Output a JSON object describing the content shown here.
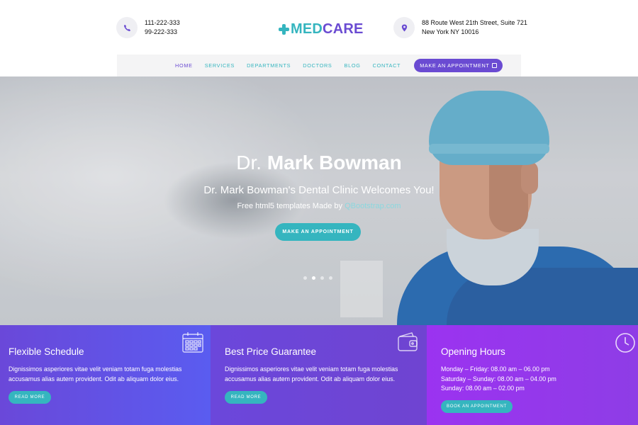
{
  "header": {
    "phone_lines": [
      "111-222-333",
      "99-222-333"
    ],
    "address_lines": [
      "88 Route West 21th Street, Suite 721",
      "New York NY 10016"
    ],
    "logo": {
      "part1": "MED",
      "part2": "CARE"
    }
  },
  "nav": {
    "items": [
      {
        "label": "HOME"
      },
      {
        "label": "SERVICES"
      },
      {
        "label": "DEPARTMENTS"
      },
      {
        "label": "DOCTORS"
      },
      {
        "label": "BLOG"
      },
      {
        "label": "CONTACT"
      }
    ],
    "active_index": 0,
    "cta_label": "MAKE AN APPOINTMENT"
  },
  "hero": {
    "title_prefix": "Dr.",
    "title_name": "Mark Bowman",
    "subtitle": "Dr. Mark Bowman's Dental Clinic Welcomes You!",
    "credit_text": "Free html5 templates Made by",
    "credit_link": "QBootstrap.com",
    "cta_label": "MAKE AN APPOINTMENT",
    "slide_count": 4,
    "active_slide": 1
  },
  "features": [
    {
      "title": "Flexible Schedule",
      "text": "Dignissimos asperiores vitae velit veniam totam fuga molestias accusamus alias autem provident. Odit ab aliquam dolor eius.",
      "button": "READ MORE",
      "icon": "calendar-icon"
    },
    {
      "title": "Best Price Guarantee",
      "text": "Dignissimos asperiores vitae velit veniam totam fuga molestias accusamus alias autem provident. Odit ab aliquam dolor eius.",
      "button": "READ MORE",
      "icon": "wallet-icon"
    },
    {
      "title": "Opening Hours",
      "hours": [
        "Monday – Friday: 08.00 am – 06.00 pm",
        "Saturday – Sunday: 08.00 am – 04.00 pm",
        "Sunday: 08.00 am – 02.00 pm"
      ],
      "button": "BOOK AN APPOINTMENT",
      "icon": "clock-icon"
    }
  ],
  "colors": {
    "accent_teal": "#35b5bf",
    "accent_purple": "#6a4bd2",
    "feature_blue": "#5a5cf0",
    "feature_violet": "#6f44d1",
    "feature_magenta": "#9b33f0"
  }
}
